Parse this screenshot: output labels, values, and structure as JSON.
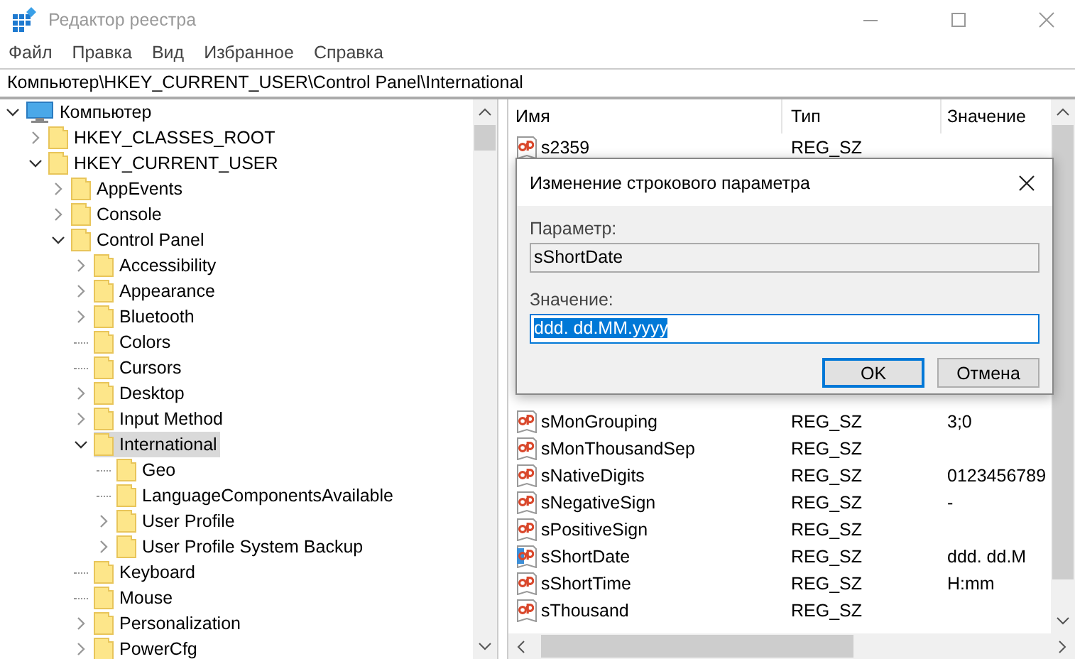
{
  "window": {
    "title": "Редактор реестра",
    "active": false
  },
  "menu": [
    "Файл",
    "Правка",
    "Вид",
    "Избранное",
    "Справка"
  ],
  "address": "Компьютер\\HKEY_CURRENT_USER\\Control Panel\\International",
  "tree": [
    {
      "label": "Компьютер",
      "kind": "computer",
      "expandable": true,
      "expanded": true,
      "selected": false,
      "children": [
        {
          "label": "HKEY_CLASSES_ROOT",
          "kind": "folder",
          "expandable": true,
          "expanded": false,
          "selected": false
        },
        {
          "label": "HKEY_CURRENT_USER",
          "kind": "folder",
          "expandable": true,
          "expanded": true,
          "selected": false,
          "children": [
            {
              "label": "AppEvents",
              "kind": "folder",
              "expandable": true,
              "expanded": false,
              "selected": false
            },
            {
              "label": "Console",
              "kind": "folder",
              "expandable": true,
              "expanded": false,
              "selected": false
            },
            {
              "label": "Control Panel",
              "kind": "folder",
              "expandable": true,
              "expanded": true,
              "selected": false,
              "children": [
                {
                  "label": "Accessibility",
                  "kind": "folder",
                  "expandable": true,
                  "expanded": false,
                  "selected": false
                },
                {
                  "label": "Appearance",
                  "kind": "folder",
                  "expandable": true,
                  "expanded": false,
                  "selected": false
                },
                {
                  "label": "Bluetooth",
                  "kind": "folder",
                  "expandable": true,
                  "expanded": false,
                  "selected": false
                },
                {
                  "label": "Colors",
                  "kind": "folder",
                  "expandable": false,
                  "selected": false
                },
                {
                  "label": "Cursors",
                  "kind": "folder",
                  "expandable": false,
                  "selected": false
                },
                {
                  "label": "Desktop",
                  "kind": "folder",
                  "expandable": true,
                  "expanded": false,
                  "selected": false
                },
                {
                  "label": "Input Method",
                  "kind": "folder",
                  "expandable": true,
                  "expanded": false,
                  "selected": false
                },
                {
                  "label": "International",
                  "kind": "folder",
                  "expandable": true,
                  "expanded": true,
                  "selected": true,
                  "children": [
                    {
                      "label": "Geo",
                      "kind": "folder",
                      "expandable": false,
                      "selected": false
                    },
                    {
                      "label": "LanguageComponentsAvailable",
                      "kind": "folder",
                      "expandable": false,
                      "selected": false
                    },
                    {
                      "label": "User Profile",
                      "kind": "folder",
                      "expandable": true,
                      "expanded": false,
                      "selected": false
                    },
                    {
                      "label": "User Profile System Backup",
                      "kind": "folder",
                      "expandable": true,
                      "expanded": false,
                      "selected": false
                    }
                  ]
                },
                {
                  "label": "Keyboard",
                  "kind": "folder",
                  "expandable": false,
                  "selected": false
                },
                {
                  "label": "Mouse",
                  "kind": "folder",
                  "expandable": false,
                  "selected": false
                },
                {
                  "label": "Personalization",
                  "kind": "folder",
                  "expandable": true,
                  "expanded": false,
                  "selected": false
                },
                {
                  "label": "PowerCfg",
                  "kind": "folder",
                  "expandable": true,
                  "expanded": false,
                  "selected": false
                }
              ]
            }
          ]
        }
      ]
    }
  ],
  "values_table": {
    "columns": [
      "Имя",
      "Тип",
      "Значение"
    ],
    "rows_above_dialog": [
      {
        "name": "s2359",
        "type": "REG_SZ"
      }
    ],
    "rows_below_dialog": [
      {
        "name": "sMonGrouping",
        "type": "REG_SZ",
        "value": "3;0",
        "focused": false
      },
      {
        "name": "sMonThousandSep",
        "type": "REG_SZ",
        "focused": false
      },
      {
        "name": "sNativeDigits",
        "type": "REG_SZ",
        "value": "0123456789",
        "focused": false
      },
      {
        "name": "sNegativeSign",
        "type": "REG_SZ",
        "value": "-",
        "focused": false
      },
      {
        "name": "sPositiveSign",
        "type": "REG_SZ",
        "focused": false
      },
      {
        "name": "sShortDate",
        "type": "REG_SZ",
        "value": "ddd. dd.M",
        "focused": true
      },
      {
        "name": "sShortTime",
        "type": "REG_SZ",
        "value": "H:mm",
        "focused": false
      },
      {
        "name": "sThousand",
        "type": "REG_SZ",
        "focused": false
      }
    ]
  },
  "dialog": {
    "title": "Изменение строкового параметра",
    "name_label": "Параметр:",
    "name_value": "sShortDate",
    "value_label": "Значение:",
    "value": "ddd. dd.MM.yyyy",
    "value_selected": true,
    "buttons": [
      {
        "label": "OK",
        "default": true
      },
      {
        "label": "Отмена",
        "default": false
      }
    ]
  }
}
